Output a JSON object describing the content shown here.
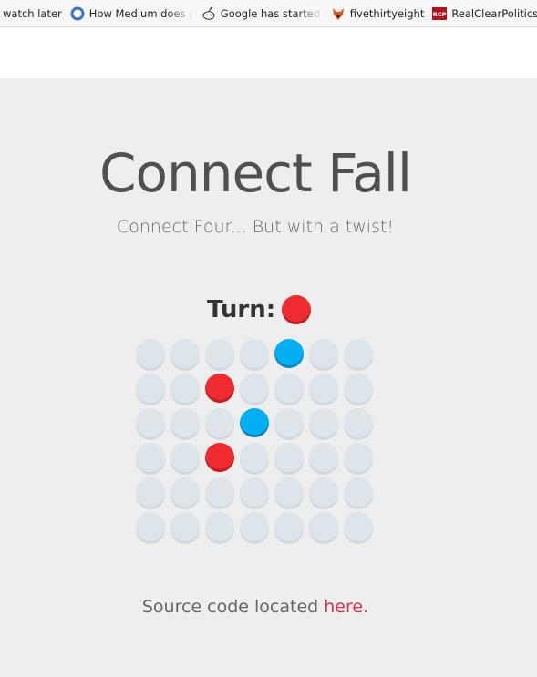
{
  "bookmarks": [
    {
      "label": "watch later",
      "icon": "none"
    },
    {
      "label": "How Medium does pr",
      "icon": "circle-o-icon"
    },
    {
      "label": "Google has started a",
      "icon": "reddit-icon"
    },
    {
      "label": "fivethirtyeight",
      "icon": "fox-icon"
    },
    {
      "label": "RealClearPolitics",
      "icon": "rcp-icon"
    }
  ],
  "game": {
    "title": "Connect Fall",
    "subtitle": "Connect Four... But with a twist!",
    "turn_label": "Turn:",
    "turn_color": "red",
    "colors": {
      "red": "#ee2b2f",
      "blue": "#03aef3",
      "empty": "#dde5ea"
    },
    "board": [
      [
        null,
        null,
        null,
        null,
        "blue",
        null,
        null
      ],
      [
        null,
        null,
        "red",
        null,
        null,
        null,
        null
      ],
      [
        null,
        null,
        null,
        "blue",
        null,
        null,
        null
      ],
      [
        null,
        null,
        "red",
        null,
        null,
        null,
        null
      ],
      [
        null,
        null,
        null,
        null,
        null,
        null,
        null
      ],
      [
        null,
        null,
        null,
        null,
        null,
        null,
        null
      ]
    ]
  },
  "footer": {
    "text": "Source code located ",
    "link_text": "here."
  }
}
